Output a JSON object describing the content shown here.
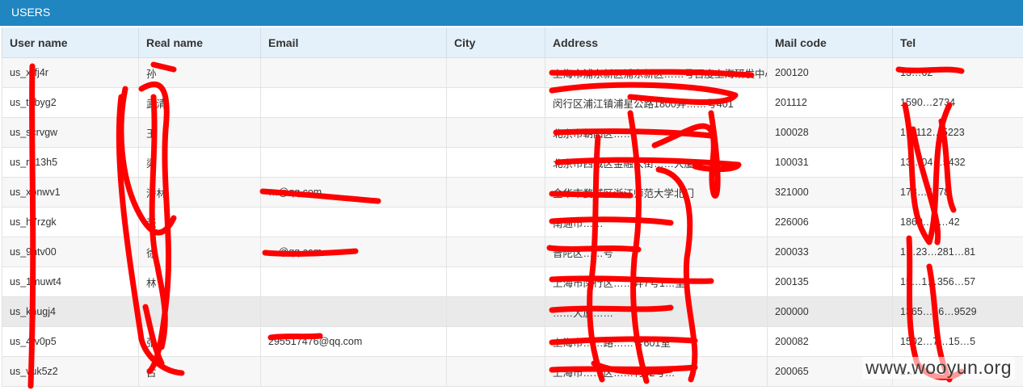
{
  "panel": {
    "title": "USERS"
  },
  "table": {
    "columns": [
      "User name",
      "Real name",
      "Email",
      "City",
      "Address",
      "Mail code",
      "Tel"
    ],
    "rows": [
      [
        "us_xrfj4r",
        "孙",
        "",
        "",
        "上海市浦东新区浦东新区……号百度上海研发中心",
        "200120",
        "13…62"
      ],
      [
        "us_t6byg2",
        "武清",
        "",
        "",
        "闵行区浦江镇浦星公路1800弄……号401",
        "201112",
        "1590…2734"
      ],
      [
        "us_scrvgw",
        "王",
        "",
        "",
        "北京市朝阳区……",
        "100028",
        "1…112…5223"
      ],
      [
        "us_r413h5",
        "梁",
        "",
        "",
        "北京市西城区金融大街……大厦……",
        "100031",
        "13…04…5432"
      ],
      [
        "us_xpnwv1",
        "潘林",
        "…@qq.com",
        "",
        "金华市婺城区浙江师范大学北门",
        "321000",
        "178…4178"
      ],
      [
        "us_h7rzgk",
        "张",
        "",
        "",
        "南通市……",
        "226006",
        "1860…5…42"
      ],
      [
        "us_9htv00",
        "徐",
        "…@qq.com",
        "",
        "普陀区……号",
        "200033",
        "1…23…281…81"
      ],
      [
        "us_1muwt4",
        "林",
        "",
        "",
        "上海市闵行区……弄7号1…室",
        "200135",
        "15…1…356…57"
      ],
      [
        "us_khugj4",
        "",
        "",
        "",
        "……大厦……",
        "200000",
        "1365…56…9529"
      ],
      [
        "us_4tv0p5",
        "张",
        "295517476@qq.com",
        "",
        "上海市……路……号601室",
        "200082",
        "1502…7…15…5"
      ],
      [
        "us_vuk5z2",
        "古",
        "",
        "",
        "上海市……区……村82号…",
        "200065",
        "1…"
      ]
    ],
    "selected_row": 8
  },
  "watermark": {
    "text": "www.wooyun.org"
  },
  "colors": {
    "titlebar": "#1f86c1",
    "header_bg": "#e5f1fa",
    "redaction": "#ff0000"
  }
}
